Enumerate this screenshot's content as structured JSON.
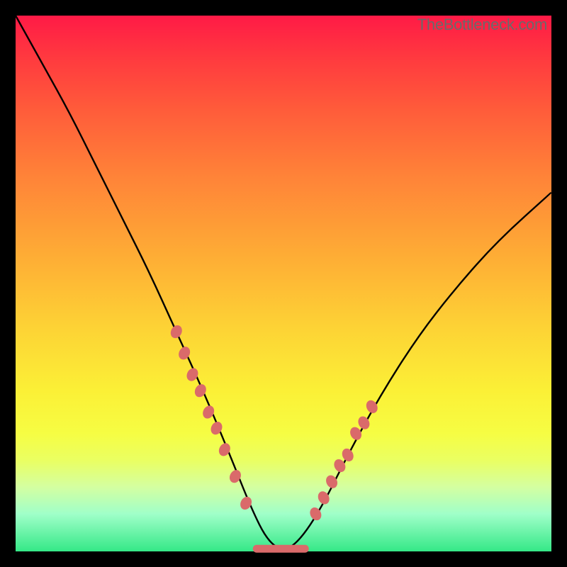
{
  "watermark": "TheBottleneck.com",
  "colors": {
    "frame": "#000000",
    "gradient_top": "#ff1a46",
    "gradient_bottom": "#35e887",
    "curve": "#000000",
    "bead": "#da6a6a"
  },
  "chart_data": {
    "type": "line",
    "title": "",
    "xlabel": "",
    "ylabel": "",
    "xlim": [
      0,
      100
    ],
    "ylim": [
      0,
      100
    ],
    "series": [
      {
        "name": "bottleneck-curve",
        "x": [
          0,
          5,
          10,
          15,
          20,
          25,
          30,
          35,
          40,
          44,
          47,
          50,
          53,
          57,
          62,
          68,
          75,
          82,
          90,
          100
        ],
        "y": [
          100,
          91,
          82,
          72,
          62,
          52,
          41,
          30,
          18,
          8,
          2,
          0,
          2,
          8,
          18,
          29,
          40,
          49,
          58,
          67
        ]
      }
    ],
    "beads_left": [
      {
        "x": 30,
        "y": 41
      },
      {
        "x": 31.5,
        "y": 37
      },
      {
        "x": 33,
        "y": 33
      },
      {
        "x": 34.5,
        "y": 30
      },
      {
        "x": 36,
        "y": 26
      },
      {
        "x": 37.5,
        "y": 23
      },
      {
        "x": 39,
        "y": 19
      },
      {
        "x": 41,
        "y": 14
      },
      {
        "x": 43,
        "y": 9
      }
    ],
    "beads_right": [
      {
        "x": 56,
        "y": 7
      },
      {
        "x": 57.5,
        "y": 10
      },
      {
        "x": 59,
        "y": 13
      },
      {
        "x": 60.5,
        "y": 16
      },
      {
        "x": 62,
        "y": 18
      },
      {
        "x": 63.5,
        "y": 22
      },
      {
        "x": 65,
        "y": 24
      },
      {
        "x": 66.5,
        "y": 27
      }
    ],
    "flat_bottom": {
      "x0": 45,
      "x1": 54,
      "y": 0.5
    }
  }
}
